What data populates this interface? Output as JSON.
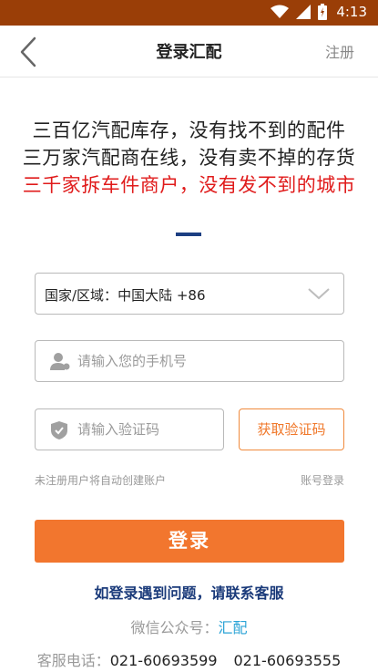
{
  "status_bar": {
    "time": "4:13"
  },
  "header": {
    "title": "登录汇配",
    "register_label": "注册"
  },
  "slogans": [
    "三百亿汽配库存，没有找不到的配件",
    "三万家汽配商在线，没有卖不掉的存货",
    "三千家拆车件商户，没有发不到的城市"
  ],
  "form": {
    "region_label": "国家/区域：",
    "region_value": "中国大陆 +86",
    "phone_placeholder": "请输入您的手机号",
    "code_placeholder": "请输入验证码",
    "get_code_label": "获取验证码",
    "auto_create_note": "未注册用户将自动创建账户",
    "account_login_label": "账号登录",
    "login_label": "登录"
  },
  "footer": {
    "help_text": "如登录遇到问题，请联系客服",
    "wechat_label": "微信公众号：",
    "wechat_name": "汇配",
    "service_label": "客服电话：",
    "phone1": "021-60693599",
    "phone2": "021-60693555"
  },
  "colors": {
    "status_bar": "#9a3e07",
    "accent_orange": "#f2762e",
    "slogan_red": "#e01b1b",
    "link_blue": "#1a3a7a",
    "wechat_blue": "#2aa3d6"
  },
  "icons": [
    "wifi-icon",
    "signal-icon",
    "battery-icon",
    "back-arrow-icon",
    "chevron-down-icon",
    "user-icon",
    "shield-icon"
  ]
}
